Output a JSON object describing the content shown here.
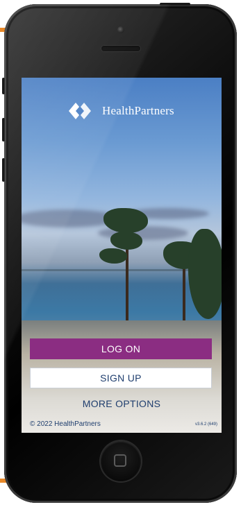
{
  "app": {
    "brand": "HealthPartners"
  },
  "actions": {
    "logon_label": "LOG ON",
    "signup_label": "SIGN UP",
    "more_options_label": "MORE OPTIONS"
  },
  "footer": {
    "copyright": "© 2022 HealthPartners",
    "version": "v3.6.2 (649)"
  },
  "colors": {
    "logon_bg": "#8b2d82",
    "text_navy": "#1f3e6e",
    "device": "#000000",
    "accent_orange": "#e8892a"
  },
  "icons": [
    "healthpartners-logo-icon",
    "home-button-icon"
  ]
}
